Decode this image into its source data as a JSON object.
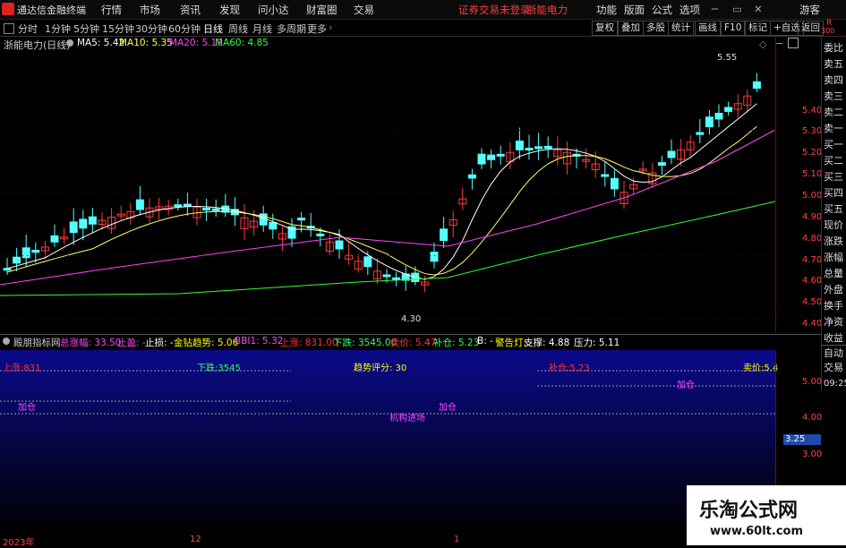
{
  "titlebar": {
    "app_title": "通达信金融终端",
    "menus": [
      "行情",
      "市场",
      "资讯",
      "发现",
      "问小达",
      "财富圈",
      "交易"
    ],
    "status": [
      "证券交易未登录",
      "浙能电力"
    ],
    "right_menus": [
      "功能",
      "版面",
      "公式",
      "选项"
    ],
    "guest": "游客"
  },
  "toolbar": {
    "periods": [
      "分时",
      "1分钟",
      "5分钟",
      "15分钟",
      "30分钟",
      "60分钟",
      "日线",
      "周线",
      "月线",
      "多周期",
      "更多"
    ],
    "active": "日线",
    "right_buttons": [
      "复权",
      "叠加",
      "多股",
      "统计",
      "画线",
      "F10",
      "标记",
      "+自选",
      "返回"
    ],
    "r_badge": "R",
    "r_number": "300"
  },
  "main_chart": {
    "name": "浙能电力(日线)",
    "ma": [
      {
        "label": "MA5: 5.42",
        "color": "#ffffff"
      },
      {
        "label": "MA10: 5.35",
        "color": "#ffff66"
      },
      {
        "label": "MA20: 5.19",
        "color": "#ff44ff"
      },
      {
        "label": "MA60: 4.85",
        "color": "#33ff33"
      }
    ],
    "y_ticks": [
      "5.40",
      "5.30",
      "5.20",
      "5.10",
      "5.00",
      "4.90",
      "4.80",
      "4.70",
      "4.60",
      "4.50",
      "4.40"
    ],
    "high_label": "5.55",
    "low_label": "4.30"
  },
  "right_panel": {
    "items": [
      "委比",
      "卖五",
      "卖四",
      "卖三",
      "卖二",
      "卖一",
      "买一",
      "买二",
      "买三",
      "买四",
      "买五",
      "现价",
      "涨跌",
      "涨幅",
      "总量",
      "外盘",
      "换手",
      "净资",
      "收益"
    ],
    "bottom": [
      "自动",
      "交易",
      "09:25"
    ]
  },
  "indicator": {
    "name": "殿朋指标网",
    "fields": [
      {
        "text": "总涨幅: 33.50",
        "color": "#ff44ff"
      },
      {
        "text": "止盈: -",
        "color": "#ff44ff"
      },
      {
        "text": "止损: -",
        "color": "#ffffff"
      },
      {
        "text": "金钻趋势: 5.06",
        "color": "#ffff00"
      },
      {
        "text": "BBI1: 5.32",
        "color": "#ff44ff"
      },
      {
        "text": "上涨: 831.00",
        "color": "#ff3333"
      },
      {
        "text": "下跌: 3545.00",
        "color": "#33ff66"
      },
      {
        "text": "卖价: 5.47",
        "color": "#ff3333"
      },
      {
        "text": "补仓: 5.23",
        "color": "#33ff66"
      },
      {
        "text": "B: -",
        "color": "#ffffff"
      },
      {
        "text": "警告灯: -",
        "color": "#ffff00"
      },
      {
        "text": "支撑: 4.88",
        "color": "#ffffff"
      },
      {
        "text": "压力: 5.11",
        "color": "#ffffff"
      }
    ],
    "labels": {
      "up": "上涨:831",
      "down": "下跌:3545",
      "trend": "趋势评分: 30",
      "add1": "加仓",
      "add2": "加仓",
      "add3": "加仓",
      "cover": "补仓:5.23",
      "sell": "卖价:5.4",
      "inst": "机构进场"
    },
    "y_ticks": [
      "5.00",
      "4.00",
      "3.00"
    ],
    "last_value": "3.25"
  },
  "xaxis": [
    "2023年",
    "12",
    "1"
  ],
  "watermark": {
    "title": "乐淘公式网",
    "url": "www.60lt.com"
  }
}
